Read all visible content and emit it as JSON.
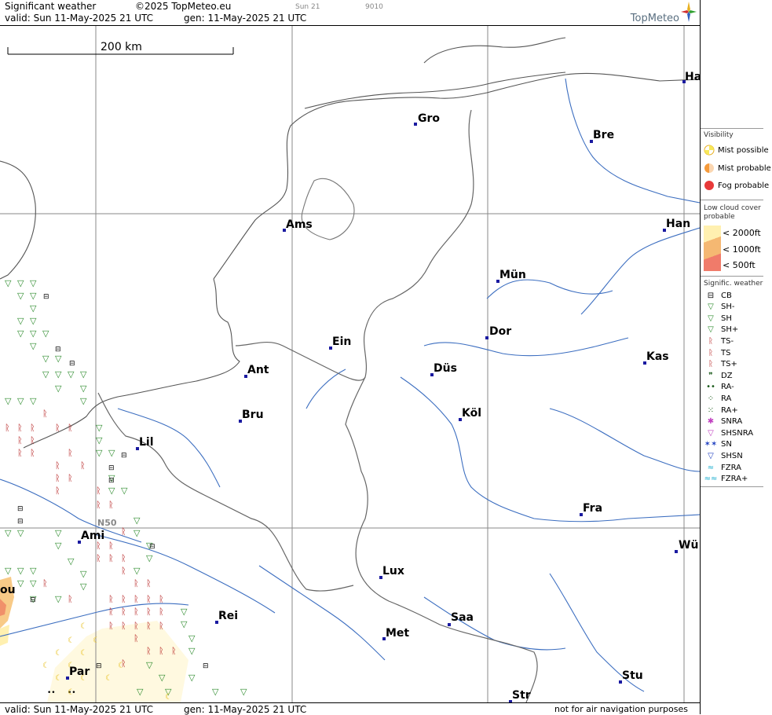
{
  "header": {
    "title": "Significant weather",
    "copyright": "©2025 TopMeteo.eu",
    "day_small": "Sun 21",
    "code_small": "9010",
    "valid": "valid:  Sun  11-May-2025  21 UTC",
    "generated": "gen: 11-May-2025 21 UTC",
    "logo": "TopMeteo"
  },
  "footer": {
    "valid": "valid:  Sun  11-May-2025  21 UTC",
    "generated": "gen: 11-May-2025 21 UTC",
    "disclaimer": "not for air navigation purposes"
  },
  "map": {
    "scale_label": "200 km",
    "lat_label": "N50",
    "cities": [
      "Ha",
      "Gro",
      "Bre",
      "Ams",
      "Han",
      "Mün",
      "Dor",
      "Ein",
      "Kas",
      "Ant",
      "Düs",
      "Bru",
      "Köl",
      "Lil",
      "Fra",
      "Ami",
      "Wü",
      "Lux",
      "Rei",
      "Saa",
      "Met",
      "Stu",
      "Par",
      "Str",
      "ou"
    ]
  },
  "legend": {
    "visibility_title": "Visibility",
    "visibility": [
      {
        "label": "Mist possible",
        "color": "#f7e85a"
      },
      {
        "label": "Mist probable",
        "color": "#f59a3a"
      },
      {
        "label": "Fog probable",
        "color": "#e83a3a"
      }
    ],
    "lowcloud_title": "Low cloud cover probable",
    "lowcloud": [
      {
        "label": "< 2000ft",
        "color": "#fff0b0"
      },
      {
        "label": "< 1000ft",
        "color": "#f5b872"
      },
      {
        "label": "<   500ft",
        "color": "#f07b6a"
      }
    ],
    "sigwx_title": "Signific. weather",
    "sigwx": [
      {
        "label": "CB",
        "icon": "cb-icon",
        "color": "#000"
      },
      {
        "label": "SH-",
        "icon": "shower-light-icon",
        "color": "#2b8a2b"
      },
      {
        "label": "SH",
        "icon": "shower-icon",
        "color": "#2b8a2b"
      },
      {
        "label": "SH+",
        "icon": "shower-heavy-icon",
        "color": "#2b8a2b"
      },
      {
        "label": "TS-",
        "icon": "thunder-light-icon",
        "color": "#b01010"
      },
      {
        "label": "TS",
        "icon": "thunder-icon",
        "color": "#b01010"
      },
      {
        "label": "TS+",
        "icon": "thunder-heavy-icon",
        "color": "#b01010"
      },
      {
        "label": "DZ",
        "icon": "drizzle-icon",
        "color": "#1a5a1a"
      },
      {
        "label": "RA-",
        "icon": "rain-light-icon",
        "color": "#1a5a1a"
      },
      {
        "label": "RA",
        "icon": "rain-icon",
        "color": "#1a5a1a"
      },
      {
        "label": "RA+",
        "icon": "rain-heavy-icon",
        "color": "#1a5a1a"
      },
      {
        "label": "SNRA",
        "icon": "snowrain-icon",
        "color": "#c040c0"
      },
      {
        "label": "SHSNRA",
        "icon": "snowrain-shower-icon",
        "color": "#c040c0"
      },
      {
        "label": "SN",
        "icon": "snow-icon",
        "color": "#2040c0"
      },
      {
        "label": "SHSN",
        "icon": "snow-shower-icon",
        "color": "#2040c0"
      },
      {
        "label": "FZRA",
        "icon": "freezing-rain-icon",
        "color": "#20b0d0"
      },
      {
        "label": "FZRA+",
        "icon": "freezing-rain-heavy-icon",
        "color": "#20b0d0"
      }
    ]
  }
}
